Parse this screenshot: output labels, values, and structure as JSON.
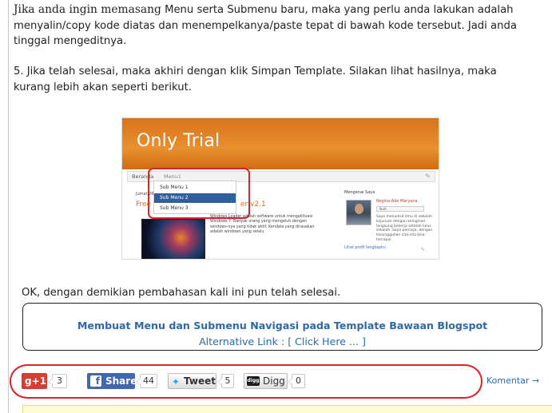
{
  "article": {
    "para1_lead": "Jika anda ingin memasang",
    "para1_rest": " Menu serta Submenu baru, maka yang perlu anda lakukan adalah menyalin/copy kode diatas dan menempelkanya/paste tepat di bawah kode tersebut. Jadi anda tinggal mengeditnya.",
    "para2": "5. Jika telah selesai, maka akhiri dengan klik Simpan Template. Silakan lihat hasilnya, maka kurang lebih akan seperti berikut.",
    "closing": "OK, dengan demikian pembahasan kali ini pun telah selesai."
  },
  "screenshot": {
    "blog_title": "Only Trial",
    "nav_home": "Beranda",
    "nav_menu": "Menu1",
    "dropdown_items": [
      "Sub Menu 1",
      "Sub Menu 2",
      "Sub Menu 3"
    ],
    "active_item": "Sub Menu 2",
    "post_date": "Jumat 26",
    "post_title_left": "Free",
    "post_title_right": "er v2.1",
    "post_body": "Windows Loader adalah software untuk mengaktivasi Windows 7. Banyak orang yang mengeluh dengan windows-nya yang tidak aktif. Kendala yang dirasakan adalah windows yang selalu",
    "sidebar_title": "Mengenai Saya",
    "sidebar_name": "Regina Ade Maryana",
    "sidebar_button": "Ikuti",
    "sidebar_text": "Saya menuntut ilmu di sekolah kejuruan dengan keinginan langsung bekerja setelah lulus sekolah. Saya percaya, dengan kesungguhan cita-cita bisa tercapai.",
    "sidebar_link": "Lihat profil lengkapku",
    "header_color": "#e07f23"
  },
  "linkbox": {
    "title": "Membuat Menu dan Submenu Navigasi pada Template Bawaan Blogspot",
    "alt_link": "Alternative Link : [ Click Here ... ]"
  },
  "share": {
    "gplus_label": "g+1",
    "gplus_count": "3",
    "facebook_label": "Share",
    "facebook_count": "44",
    "twitter_label": "Tweet",
    "twitter_count": "5",
    "digg_icon_text": "digg",
    "digg_label": "Digg",
    "digg_count": "0",
    "komentar_label": "Komentar →"
  },
  "colors": {
    "link_blue": "#2c6aa8",
    "highlight_red": "#e0202a",
    "facebook_blue": "#4267b2",
    "gplus_red": "#d73d32"
  }
}
